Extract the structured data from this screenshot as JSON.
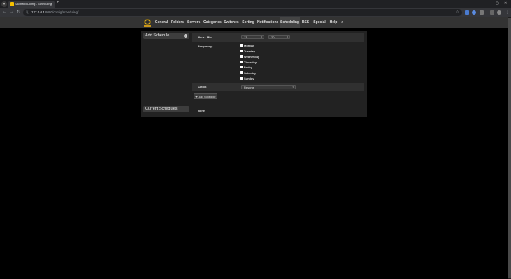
{
  "browser": {
    "tab_title": "SABnzbd Config - Scheduling",
    "url_host": "127.0.0.1",
    "url_path": ":8080/config/scheduling/"
  },
  "nav": {
    "items": [
      "General",
      "Folders",
      "Servers",
      "Categories",
      "Switches",
      "Sorting",
      "Notifications",
      "Scheduling",
      "RSS",
      "Special",
      "Help"
    ],
    "active": "Scheduling"
  },
  "add_schedule": {
    "heading": "Add Schedule",
    "hour_min_label": "Hour : Min",
    "hour_value": "13",
    "minute_value": "20",
    "colon": ":",
    "frequency_label": "Frequency",
    "days": [
      "Monday",
      "Tuesday",
      "Wednesday",
      "Thursday",
      "Friday",
      "Saturday",
      "Sunday"
    ],
    "action_label": "Action",
    "action_value": "Resume",
    "add_button_label": "Add Schedule"
  },
  "current_schedules": {
    "heading": "Current Schedules",
    "empty_text": "None"
  },
  "colors": {
    "page_bg": "#000000",
    "nav_bg": "#333333",
    "panel_bg": "#222222",
    "logo": "#e5b31f"
  },
  "icons": [
    "back-icon",
    "forward-icon",
    "reload-icon",
    "info-icon",
    "star-icon",
    "search-icon",
    "plus-icon",
    "logo-icon"
  ]
}
